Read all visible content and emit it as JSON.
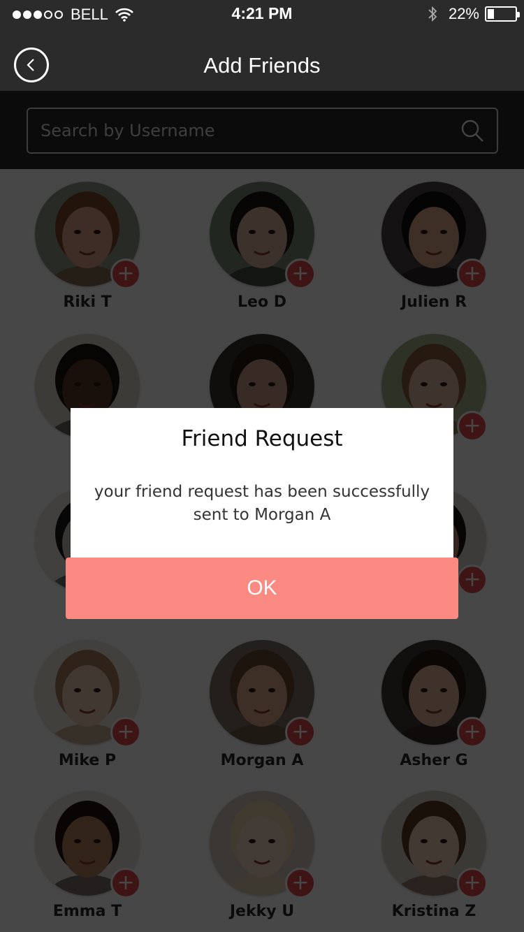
{
  "status_bar": {
    "carrier": "BELL",
    "time": "4:21 PM",
    "battery": "22%",
    "signal_dots_filled": 3,
    "signal_dots_total": 5
  },
  "nav": {
    "title": "Add Friends",
    "back_icon": "chevron-left-icon"
  },
  "search": {
    "placeholder": "Search by Username",
    "icon": "search-icon"
  },
  "friends": [
    {
      "name": "Riki T",
      "skin": "#d9a38a",
      "hair": "#7a4a2a",
      "bg": "#8f9a85"
    },
    {
      "name": "Leo D",
      "skin": "#d8b29a",
      "hair": "#1c1712",
      "bg": "#7b8a78"
    },
    {
      "name": "Julien R",
      "skin": "#d9a98a",
      "hair": "#151010",
      "bg": "#4a4040"
    },
    {
      "name": "",
      "skin": "#5a3a28",
      "hair": "#1a120c",
      "bg": "#d9d2c8"
    },
    {
      "name": "",
      "skin": "#c99a84",
      "hair": "#241a14",
      "bg": "#3a3030"
    },
    {
      "name": "",
      "skin": "#e3b8a0",
      "hair": "#8a5a36",
      "bg": "#a3b08a"
    },
    {
      "name": "",
      "skin": "#c7c0b8",
      "hair": "#1a1a1a",
      "bg": "#e8e4de"
    },
    {
      "name": "",
      "skin": "#cfa690",
      "hair": "#3a2a1e",
      "bg": "#8a8080"
    },
    {
      "name": "",
      "skin": "#b98a70",
      "hair": "#1a1410",
      "bg": "#d8d4ce"
    },
    {
      "name": "Mike P",
      "skin": "#e8c8b0",
      "hair": "#a87e5a",
      "bg": "#eae4da"
    },
    {
      "name": "Morgan A",
      "skin": "#d9a88a",
      "hair": "#6a4a30",
      "bg": "#7a7068"
    },
    {
      "name": "Asher G",
      "skin": "#e0b49a",
      "hair": "#2a1c14",
      "bg": "#3e3a38"
    },
    {
      "name": "Emma T",
      "skin": "#b7825f",
      "hair": "#1e1410",
      "bg": "#e8e2da"
    },
    {
      "name": "Jekky U",
      "skin": "#f0d2c2",
      "hair": "#e4d0a8",
      "bg": "#cfc6bc"
    },
    {
      "name": "Kristina Z",
      "skin": "#efcbb6",
      "hair": "#5e3a24",
      "bg": "#d4ccc2"
    }
  ],
  "dialog": {
    "title": "Friend Request",
    "message": "your friend request has been successfully sent to Morgan A",
    "ok_label": "OK"
  },
  "colors": {
    "accent": "#fb8a82",
    "add_button": "#e24a4a",
    "header": "#2b2b2b"
  }
}
